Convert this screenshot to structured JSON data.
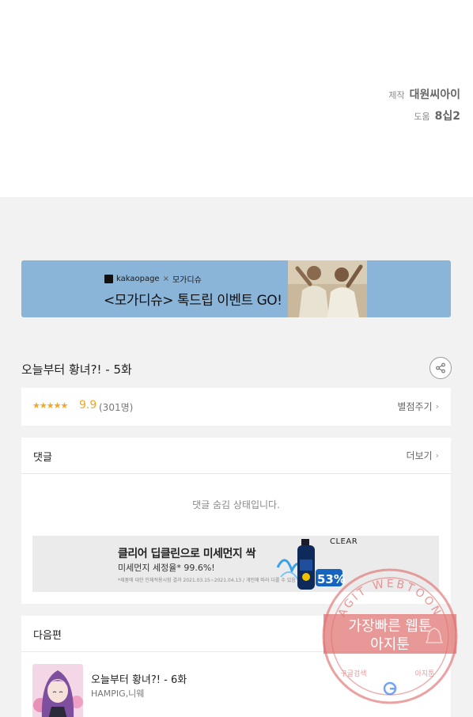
{
  "credits": {
    "production_label": "제작",
    "production_value": "대원씨아이",
    "assist_label": "도움",
    "assist_value": "8십2"
  },
  "banner": {
    "brand": "kakaopage",
    "separator": "×",
    "partner": "모가디슈",
    "title": "<모가디슈> 톡드립 이벤트 GO!"
  },
  "episode": {
    "title": "오늘부터 황녀?! - 5화"
  },
  "rating": {
    "stars": "★★★★★",
    "score": "9.9",
    "count": "(301명)",
    "rate_label": "별점주기"
  },
  "comments": {
    "title": "댓글",
    "more_label": "더보기",
    "hidden_message": "댓글 숨김 상태입니다."
  },
  "ad": {
    "headline": "클리어 딥클린으로 미세먼지 싹",
    "subline": "미세먼지 세정율* 99.6%!",
    "fine_print": "*제품에 대한 인체적용시험 결과 2021.03.15~2021.04.13 / 개인에 따라 다를 수 있음",
    "brand": "CLEAR",
    "badge": "53%"
  },
  "next": {
    "title": "다음편",
    "episode_title": "오늘부터 황녀?! - 6화",
    "authors": "HAMPIG,니웨"
  },
  "watermark": {
    "top_text": "AGIT WEBTOON",
    "line1": "가장빠른 웹툰",
    "line2": "아지툰",
    "bottom_left": "구글검색",
    "bottom_right": "아지툰"
  },
  "colors": {
    "star": "#f5a623",
    "banner_bg": "#8ab4d8",
    "watermark": "#e07070"
  }
}
